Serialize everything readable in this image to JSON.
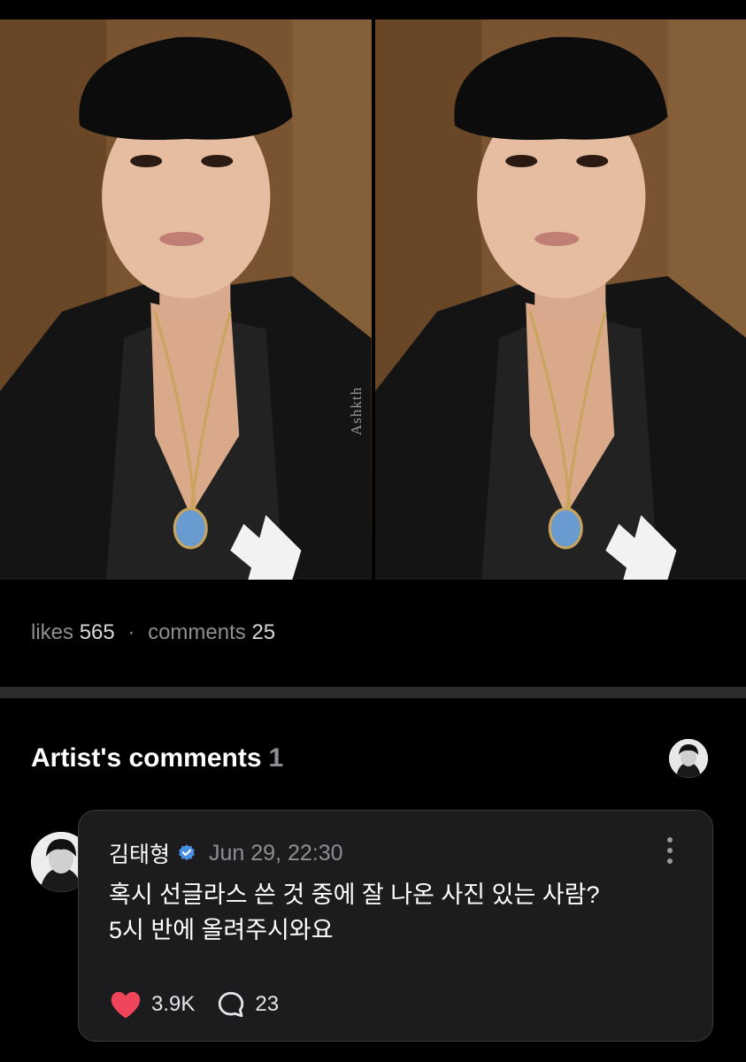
{
  "post": {
    "photos": [
      {
        "alt": "photo-left",
        "watermark": "Ashkth"
      },
      {
        "alt": "photo-right",
        "watermark": ""
      }
    ],
    "stats": {
      "likes_label": "likes",
      "likes_count": "565",
      "separator": "·",
      "comments_label": "comments",
      "comments_count": "25"
    }
  },
  "artist_comments": {
    "title": "Artist's comments",
    "count": "1",
    "comment": {
      "author": "김태형",
      "verified": true,
      "timestamp": "Jun 29, 22:30",
      "text": "혹시 선글라스 쓴 것 중에 잘 나온 사진 있는 사람?\n5시 반에 올려주시와요",
      "likes": "3.9K",
      "replies": "23"
    }
  },
  "colors": {
    "background": "#000000",
    "card": "#1c1c1e",
    "muted_text": "#8e8e93",
    "heart": "#f0445a",
    "verified": "#4a90e2"
  },
  "icons": [
    "more-vertical-icon",
    "heart-icon",
    "reply-bubble-icon",
    "verified-badge-icon"
  ]
}
